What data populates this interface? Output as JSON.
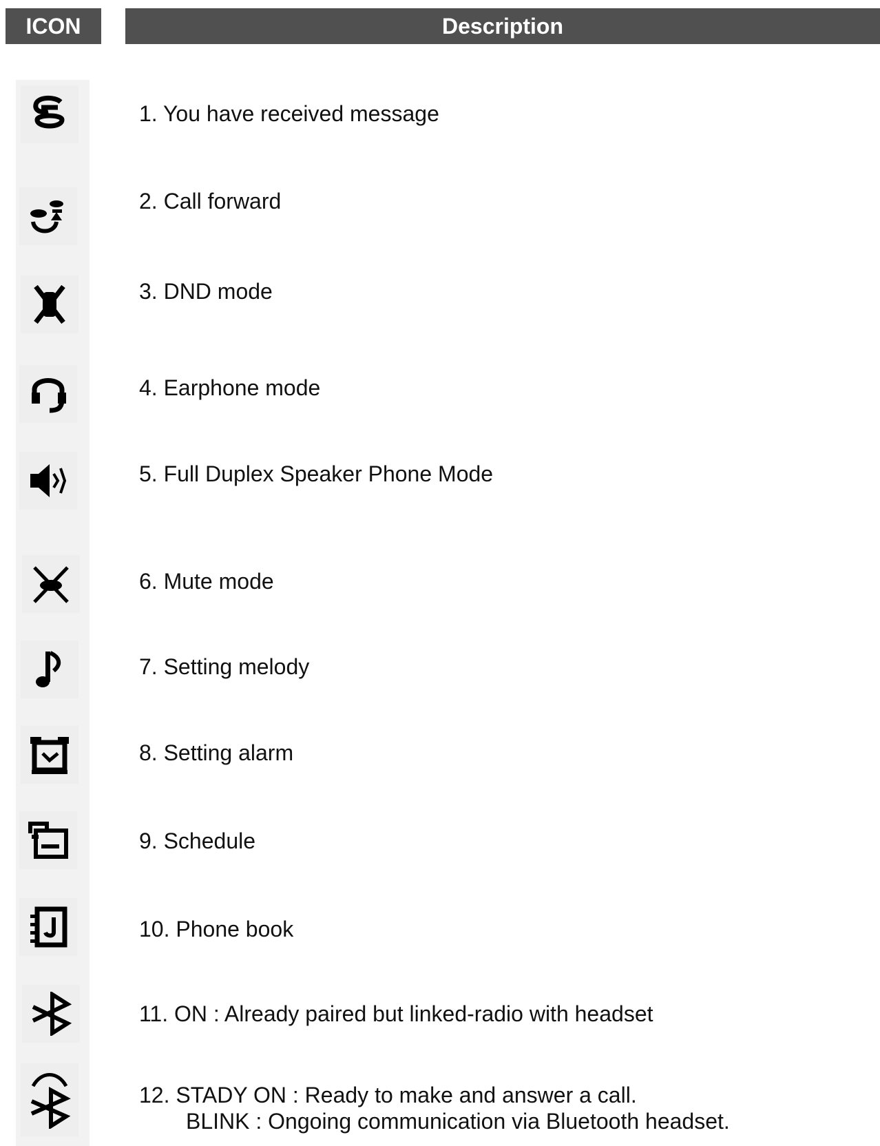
{
  "header": {
    "icon_col": "ICON",
    "description_col": "Description"
  },
  "rows": [
    {
      "icon": "message-icon",
      "text": "1. You have received message"
    },
    {
      "icon": "call-forward-icon",
      "text": "2. Call forward"
    },
    {
      "icon": "dnd-icon",
      "text": "3. DND mode"
    },
    {
      "icon": "headset-icon",
      "text": "4. Earphone mode"
    },
    {
      "icon": "speaker-icon",
      "text": "5. Full Duplex Speaker Phone Mode"
    },
    {
      "icon": "mute-icon",
      "text": "6. Mute mode"
    },
    {
      "icon": "music-note-icon",
      "text": "7. Setting melody"
    },
    {
      "icon": "alarm-clock-icon",
      "text": "8. Setting alarm"
    },
    {
      "icon": "schedule-icon",
      "text": "9. Schedule"
    },
    {
      "icon": "phone-book-icon",
      "text": "10. Phone book"
    },
    {
      "icon": "bluetooth-icon",
      "text": "11. ON : Already paired but linked-radio with headset"
    },
    {
      "icon": "bluetooth-signal-icon",
      "text": "12. STADY ON : Ready to make and answer a call.",
      "text2": "BLINK : Ongoing communication via Bluetooth headset."
    }
  ]
}
